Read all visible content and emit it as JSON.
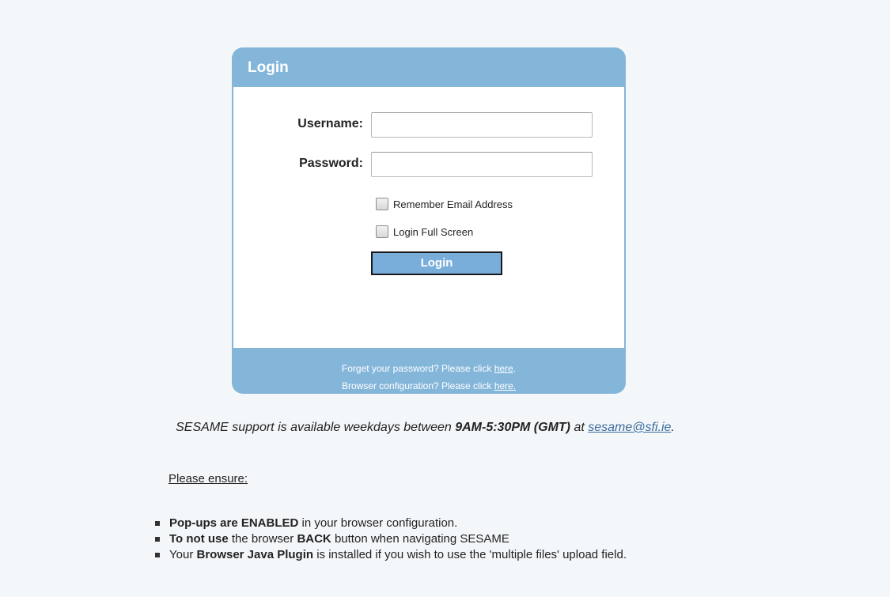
{
  "login": {
    "title": "Login",
    "username_label": "Username:",
    "username_value": "",
    "password_label": "Password:",
    "password_value": "",
    "remember_label": "Remember Email Address",
    "remember_checked": false,
    "fullscreen_label": "Login Full Screen",
    "fullscreen_checked": false,
    "button_label": "Login",
    "forgot_text": "Forget your password? Please click",
    "forgot_link": "here",
    "forgot_suffix": ".",
    "browser_text": "Browser configuration? Please click",
    "browser_link": "here."
  },
  "support": {
    "prefix": "SESAME support is available weekdays between",
    "hours": "9AM-5:30PM (GMT)",
    "middle": "at",
    "email": "sesame@sfi.ie",
    "suffix": "."
  },
  "ensure_heading": "Please ensure:",
  "notes": [
    {
      "bold": "Pop-ups are ENABLED",
      "rest": "in your browser configuration."
    },
    {
      "bold": "To not use",
      "rest": "the browser",
      "bold2": "BACK",
      "rest2": "button when navigating SESAME"
    },
    {
      "lead": "Your",
      "bold": "Browser Java Plugin",
      "rest": "is installed if you wish to use the 'multiple files' upload field."
    }
  ],
  "colors": {
    "panel": "#84b6da",
    "button": "#79aedb",
    "background": "#f4f7fa",
    "link": "#3a6b9e"
  }
}
